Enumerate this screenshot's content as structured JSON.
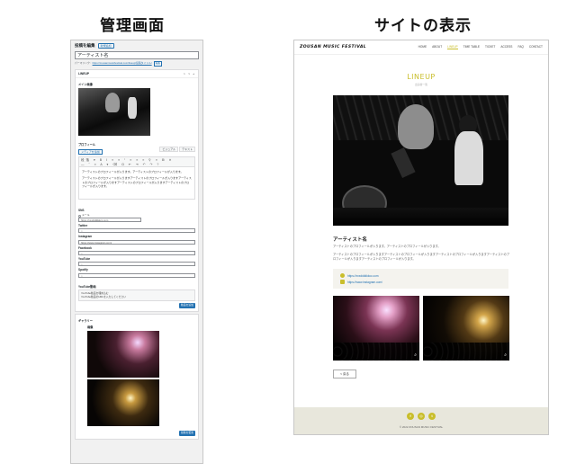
{
  "headings": {
    "admin": "管理画面",
    "site": "サイトの表示"
  },
  "admin": {
    "page_title": "投稿を編集",
    "add_new": "新規追加",
    "post_title": "アーティスト名",
    "permalink_label": "パーマリンク:",
    "permalink_url": "https://zousanmusicfestival.com/lineup/投稿タイトル/",
    "permalink_ok": "編集",
    "box_title": "LINEUP",
    "box_controls": "∧ ∨ ▴",
    "main_image_label": "メイン画像",
    "profile_label": "プロフィール",
    "add_media": "メディアを追加",
    "tab_visual": "ビジュアル",
    "tab_text": "テキスト",
    "toolbar_row1": "段落 ▾ B I ≡ ≡ “ ≡ ≡ ≡ ⚲ ≡ ⊞ ✕",
    "toolbar_row2": "— ‾ ≡ A ▾ ⌫ Ω ⇤ ⇥ ↶ ↷ ?",
    "profile_text_1": "アーティストのプロフィールが入ります。アーティストのプロフィールが入ります。",
    "profile_text_2": "アーティストのプロフィールが入りますアーティストのプロフィールが入りますアーティストのプロフィールが入りますアーティストのプロフィールが入りますアーティストのプロフィールが入ります。",
    "sns_label": "SNS",
    "radio_label": "メール",
    "website_url": "https://xxxdddkkkcc.com",
    "twitter_label": "Twitter",
    "twitter_value": "○",
    "instagram_label": "Instagram",
    "instagram_value": "https://www.instagram.com/",
    "facebook_label": "Facebook",
    "facebook_value": "○",
    "youtube_label": "YouTube",
    "youtube_value": "○",
    "spotify_label": "Spotify",
    "spotify_value": "○",
    "yt_embed_label": "YouTube動画",
    "yt_embed_title": "YouTube動画を埋め込む",
    "yt_embed_hint": "YouTube動画のURLを入力してください",
    "yt_embed_button": "動画を追加",
    "gallery_section": "ギャラリー",
    "gallery_label": "画像",
    "update_button": "投稿を更新"
  },
  "site": {
    "logo": "ZOUSAN MUSIC FESTIVAL",
    "nav": [
      "HOME",
      "ABOUT",
      "LINEUP",
      "TIME TABLE",
      "TICKET",
      "ACCESS",
      "FAQ",
      "CONTACT"
    ],
    "section_title": "LINEUP",
    "section_sub": "出演者一覧",
    "artist_name": "アーティスト名",
    "desc_1": "アーティストのプロフィールが入ります。アーティストのプロフィールが入ります。",
    "desc_2": "アーティストのプロフィールが入りますアーティストのプロフィールが入りますアーティストのプロフィールが入りますアーティストのプロフィールが入りますアーティストのプロフィールが入ります。",
    "link_1": "https://xxxdddkkkcc.com",
    "link_2": "https://www.instagram.com/",
    "back_button": "< 戻る",
    "copyright": "© 2022 ZOUSAN MUSIC FESTIVAL",
    "accent_color": "#c9be2b"
  }
}
